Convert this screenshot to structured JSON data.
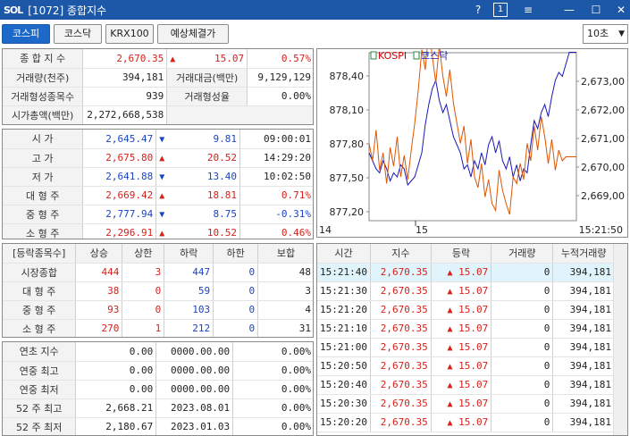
{
  "window": {
    "logo": "SOL",
    "title": "[1072] 종합지수",
    "help": "?",
    "one": "1",
    "menu": "≡",
    "min": "—",
    "max": "☐",
    "close": "✕"
  },
  "tabs": [
    {
      "label": "코스피"
    },
    {
      "label": "코스닥"
    },
    {
      "label": "KRX100"
    },
    {
      "label": "예상체결가"
    }
  ],
  "interval": {
    "value": "10초"
  },
  "summary": {
    "r1": {
      "label": "종 합 지 수",
      "value": "2,670.35",
      "change": "15.07",
      "pct": "0.57%"
    },
    "r2": {
      "l1": "거래량(천주)",
      "v1": "394,181",
      "l2": "거래대금(백만)",
      "v2": "9,129,129"
    },
    "r3": {
      "l1": "거래형성종목수",
      "v1": "939",
      "l2": "거래형성율",
      "v2": "0.00%"
    },
    "r4": {
      "l1": "시가총액(백만)",
      "v1": "2,272,668,538"
    }
  },
  "prices": [
    {
      "label": "시    가",
      "value": "2,645.47",
      "dir": "down",
      "change": "9.81",
      "extra": "09:00:01",
      "vc": "blue",
      "ec": "black"
    },
    {
      "label": "고    가",
      "value": "2,675.80",
      "dir": "up",
      "change": "20.52",
      "extra": "14:29:20",
      "vc": "red",
      "ec": "black"
    },
    {
      "label": "저    가",
      "value": "2,641.88",
      "dir": "down",
      "change": "13.40",
      "extra": "10:02:50",
      "vc": "blue",
      "ec": "black"
    },
    {
      "label": "대 형 주",
      "value": "2,669.42",
      "dir": "up",
      "change": "18.81",
      "extra": "0.71%",
      "vc": "red",
      "ec": "red"
    },
    {
      "label": "중 형 주",
      "value": "2,777.94",
      "dir": "down",
      "change": "8.75",
      "extra": "-0.31%",
      "vc": "blue",
      "ec": "blue"
    },
    {
      "label": "소 형 주",
      "value": "2,296.91",
      "dir": "up",
      "change": "10.52",
      "extra": "0.46%",
      "vc": "red",
      "ec": "red"
    }
  ],
  "breadth": {
    "headers": [
      "[등락종목수]",
      "상승",
      "상한",
      "하락",
      "하한",
      "보합"
    ],
    "rows": [
      {
        "label": "시장종합",
        "c": [
          "444",
          "3",
          "447",
          "0",
          "48"
        ]
      },
      {
        "label": "대 형 주",
        "c": [
          "38",
          "0",
          "59",
          "0",
          "3"
        ]
      },
      {
        "label": "중 형 주",
        "c": [
          "93",
          "0",
          "103",
          "0",
          "4"
        ]
      },
      {
        "label": "소 형 주",
        "c": [
          "270",
          "1",
          "212",
          "0",
          "31"
        ]
      }
    ]
  },
  "records": [
    {
      "label": "연초  지수",
      "v": "0.00",
      "d": "0000.00.00",
      "p": "0.00%"
    },
    {
      "label": "연중  최고",
      "v": "0.00",
      "d": "0000.00.00",
      "p": "0.00%"
    },
    {
      "label": "연중  최저",
      "v": "0.00",
      "d": "0000.00.00",
      "p": "0.00%"
    },
    {
      "label": "52 주 최고",
      "v": "2,668.21",
      "d": "2023.08.01",
      "p": "0.00%"
    },
    {
      "label": "52 주 최저",
      "v": "2,180.67",
      "d": "2023.01.03",
      "p": "0.00%"
    }
  ],
  "ticks": {
    "headers": [
      "시간",
      "지수",
      "등락",
      "거래량",
      "누적거래량"
    ],
    "rows": [
      {
        "t": "15:21:40",
        "i": "2,670.35",
        "c": "15.07",
        "v": "0",
        "a": "394,181"
      },
      {
        "t": "15:21:30",
        "i": "2,670.35",
        "c": "15.07",
        "v": "0",
        "a": "394,181"
      },
      {
        "t": "15:21:20",
        "i": "2,670.35",
        "c": "15.07",
        "v": "0",
        "a": "394,181"
      },
      {
        "t": "15:21:10",
        "i": "2,670.35",
        "c": "15.07",
        "v": "0",
        "a": "394,181"
      },
      {
        "t": "15:21:00",
        "i": "2,670.35",
        "c": "15.07",
        "v": "0",
        "a": "394,181"
      },
      {
        "t": "15:20:50",
        "i": "2,670.35",
        "c": "15.07",
        "v": "0",
        "a": "394,181"
      },
      {
        "t": "15:20:40",
        "i": "2,670.35",
        "c": "15.07",
        "v": "0",
        "a": "394,181"
      },
      {
        "t": "15:20:30",
        "i": "2,670.35",
        "c": "15.07",
        "v": "0",
        "a": "394,181"
      },
      {
        "t": "15:20:20",
        "i": "2,670.35",
        "c": "15.07",
        "v": "0",
        "a": "394,181"
      }
    ]
  },
  "chart_data": {
    "type": "line",
    "legend": [
      "KOSPI",
      "코스닥"
    ],
    "left_ticks": [
      "878,40",
      "878,10",
      "877,80",
      "877,50",
      "877,20"
    ],
    "right_ticks": [
      "2,673,00",
      "2,672,00",
      "2,671,00",
      "2,670,00",
      "2,669,00"
    ],
    "x_ticks": [
      "14",
      "15",
      "15:21:50"
    ],
    "left_ylim": [
      877.2,
      878.4
    ],
    "right_ylim": [
      2669.0,
      2673.0
    ],
    "series": [
      {
        "name": "KOSPI",
        "color": "#1a1ab8",
        "values": [
          2670.6,
          2670.4,
          2670.2,
          2670.1,
          2670.4,
          2670.2,
          2669.9,
          2670.1,
          2670.0,
          2670.3,
          2670.2,
          2669.8,
          2669.9,
          2670.0,
          2670.3,
          2670.6,
          2671.3,
          2671.8,
          2672.2,
          2672.4,
          2671.9,
          2671.6,
          2671.8,
          2671.4,
          2671.0,
          2670.8,
          2670.6,
          2670.2,
          2670.3,
          2670.0,
          2670.4,
          2670.2,
          2670.6,
          2670.3,
          2670.8,
          2671.0,
          2670.6,
          2670.9,
          2670.4,
          2670.2,
          2670.5,
          2670.0,
          2670.3,
          2669.9,
          2670.2,
          2670.1,
          2670.8,
          2671.4,
          2671.2,
          2671.6,
          2671.8,
          2671.5,
          2672.0,
          2672.4,
          2672.6,
          2672.5,
          2672.8,
          2673.1,
          2673.1,
          2673.1
        ]
      },
      {
        "name": "코스닥",
        "color": "#dd5500",
        "values": [
          877.75,
          877.62,
          877.85,
          877.55,
          877.68,
          877.45,
          877.72,
          877.58,
          877.8,
          877.5,
          877.66,
          877.48,
          877.7,
          877.9,
          878.15,
          878.45,
          878.3,
          878.6,
          878.4,
          878.2,
          878.48,
          878.25,
          878.1,
          878.3,
          878.05,
          877.9,
          877.75,
          877.88,
          877.6,
          877.78,
          877.5,
          877.42,
          877.6,
          877.35,
          877.48,
          877.3,
          877.25,
          877.55,
          877.4,
          877.3,
          877.22,
          877.5,
          877.45,
          877.6,
          877.48,
          877.75,
          877.62,
          877.88,
          877.7,
          877.95,
          877.8,
          877.6,
          877.78,
          877.55,
          877.7,
          877.62,
          877.65,
          877.65,
          877.65,
          877.65
        ]
      }
    ]
  }
}
